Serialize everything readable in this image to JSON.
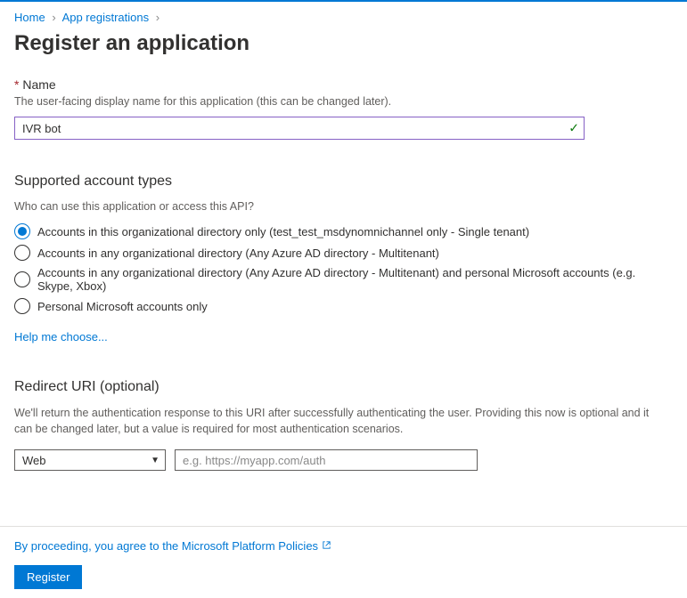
{
  "breadcrumb": {
    "home": "Home",
    "appreg": "App registrations"
  },
  "title": "Register an application",
  "name_section": {
    "required_star": "*",
    "label": "Name",
    "helper": "The user-facing display name for this application (this can be changed later).",
    "value": "IVR bot"
  },
  "account_section": {
    "heading": "Supported account types",
    "question": "Who can use this application or access this API?",
    "options": [
      "Accounts in this organizational directory only (test_test_msdynomnichannel only - Single tenant)",
      "Accounts in any organizational directory (Any Azure AD directory - Multitenant)",
      "Accounts in any organizational directory (Any Azure AD directory - Multitenant) and personal Microsoft accounts (e.g. Skype, Xbox)",
      "Personal Microsoft accounts only"
    ],
    "help_link": "Help me choose..."
  },
  "redirect_section": {
    "heading": "Redirect URI (optional)",
    "description": "We'll return the authentication response to this URI after successfully authenticating the user. Providing this now is optional and it can be changed later, but a value is required for most authentication scenarios.",
    "platform_selected": "Web",
    "uri_placeholder": "e.g. https://myapp.com/auth"
  },
  "footer": {
    "policy_text": "By proceeding, you agree to the Microsoft Platform Policies",
    "register_label": "Register"
  }
}
